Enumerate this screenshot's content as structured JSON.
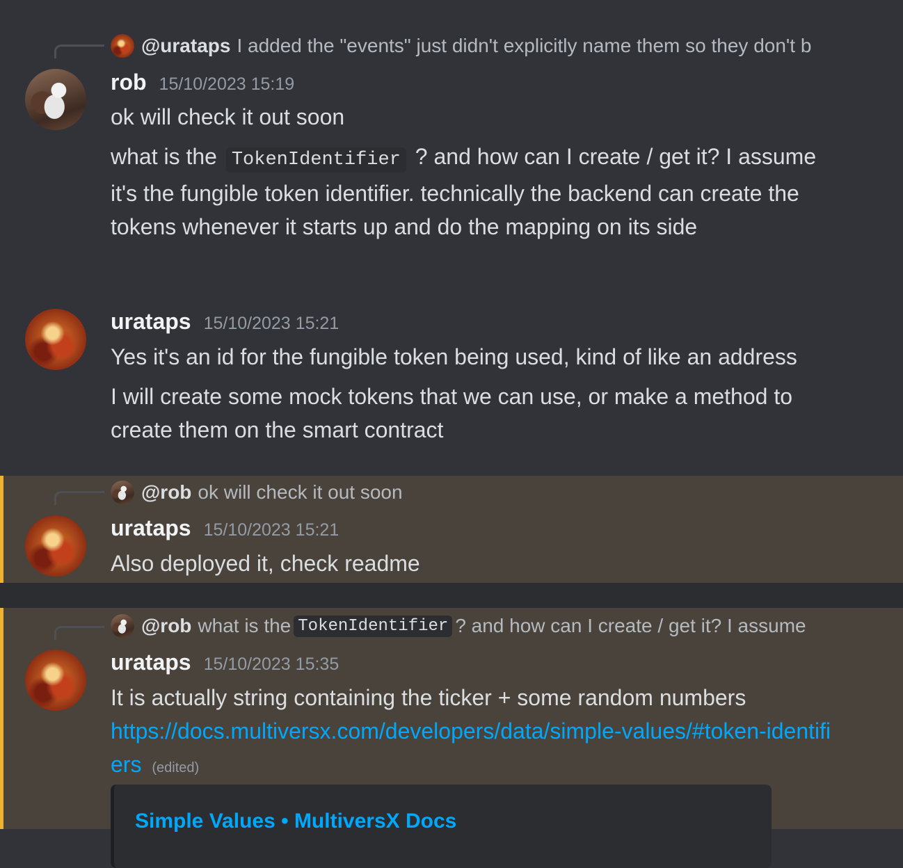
{
  "messages": [
    {
      "reply_preview": {
        "mention": "@urataps",
        "text": "I added the \"events\" just didn't explicitly name them so they don't b"
      },
      "author": "rob",
      "timestamp": "15/10/2023 15:19",
      "lines": [
        "ok will check it out soon"
      ],
      "para2": {
        "before": "what is the",
        "code": "TokenIdentifier",
        "after": "? and how can I create / get it? I assume it's the fungible token identifier. technically the backend can create the tokens whenever it starts up and do the mapping on its side"
      }
    },
    {
      "author": "urataps",
      "timestamp": "15/10/2023 15:21",
      "line1": "Yes it's an id for the fungible token being used, kind of like an address",
      "line2": "I will create some mock tokens that we can use, or make a method to create them on the smart contract"
    },
    {
      "reply_preview": {
        "mention": "@rob",
        "text": "ok will check it out soon"
      },
      "author": "urataps",
      "timestamp": "15/10/2023 15:21",
      "line1": "Also deployed it, check readme"
    },
    {
      "reply_preview": {
        "mention": "@rob",
        "before": "what is the",
        "code": "TokenIdentifier",
        "after": "? and how can I create / get it? I assume"
      },
      "author": "urataps",
      "timestamp": "15/10/2023 15:35",
      "line1": "It is actually string containing the ticker + some random numbers",
      "link": "https://docs.multiversx.com/developers/data/simple-values/#token-identifiers",
      "edited": "(edited)",
      "embed_title": "Simple Values • MultiversX Docs"
    }
  ],
  "colors": {
    "background": "#313338",
    "highlight": "#4a433b",
    "highlight_bar": "#f0b132",
    "link": "#00a8fc"
  }
}
